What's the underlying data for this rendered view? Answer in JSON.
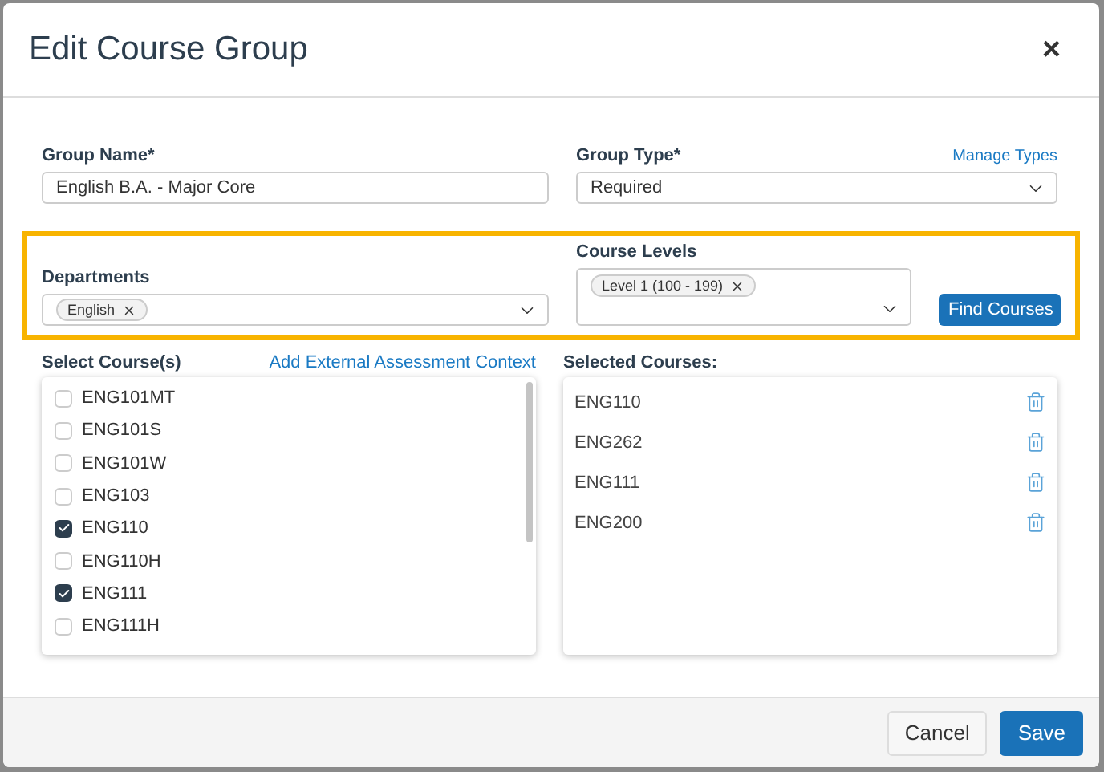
{
  "dialog": {
    "title": "Edit Course Group",
    "close": "×"
  },
  "group_name": {
    "label": "Group Name*",
    "value": "English B.A. - Major Core"
  },
  "group_type": {
    "label": "Group Type*",
    "link": "Manage Types",
    "value": "Required"
  },
  "departments": {
    "label": "Departments",
    "tags": [
      "English"
    ]
  },
  "course_levels": {
    "label": "Course Levels",
    "tags": [
      "Level 1 (100 - 199)"
    ]
  },
  "find_button": "Find Courses",
  "select_courses": {
    "label": "Select Course(s)",
    "link": "Add External Assessment Context",
    "items": [
      {
        "code": "ENG101MT",
        "checked": false
      },
      {
        "code": "ENG101S",
        "checked": false
      },
      {
        "code": "ENG101W",
        "checked": false
      },
      {
        "code": "ENG103",
        "checked": false
      },
      {
        "code": "ENG110",
        "checked": true
      },
      {
        "code": "ENG110H",
        "checked": false
      },
      {
        "code": "ENG111",
        "checked": true
      },
      {
        "code": "ENG111H",
        "checked": false
      }
    ]
  },
  "selected_courses": {
    "label": "Selected Courses:",
    "items": [
      "ENG110",
      "ENG262",
      "ENG111",
      "ENG200"
    ]
  },
  "buttons": [
    {
      "label": "Cancel",
      "kind": "secondary"
    },
    {
      "label": "Save",
      "kind": "primary"
    }
  ]
}
